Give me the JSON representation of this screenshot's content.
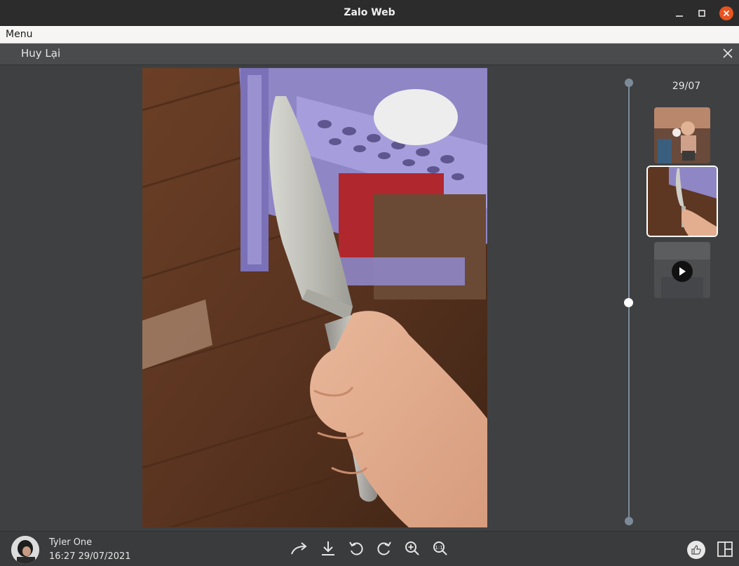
{
  "window": {
    "title": "Zalo Web",
    "close_color": "#e95420"
  },
  "menubar": {
    "menu_label": "Menu"
  },
  "viewer": {
    "sender_name": "Huy Lại",
    "timeline_date": "29/07",
    "thumbnails": [
      {
        "kind": "photo",
        "subject": "child-photo",
        "selected": false
      },
      {
        "kind": "photo",
        "subject": "knife-photo",
        "selected": true
      },
      {
        "kind": "video",
        "subject": "video-clip",
        "selected": false
      }
    ],
    "main_image_subject": "hand-holding-knife"
  },
  "footer": {
    "user_name": "Tyler One",
    "timestamp": "16:27 29/07/2021",
    "tools": [
      "share-forward-icon",
      "download-icon",
      "rotate-left-icon",
      "rotate-right-icon",
      "zoom-in-icon",
      "actual-size-icon"
    ],
    "like_icon": "thumbs-up-icon",
    "layout_icon": "layout-grid-icon"
  },
  "colors": {
    "viewer_bg": "#3f4042",
    "timeline": "#7c8a99",
    "accent_white": "#ffffff"
  }
}
